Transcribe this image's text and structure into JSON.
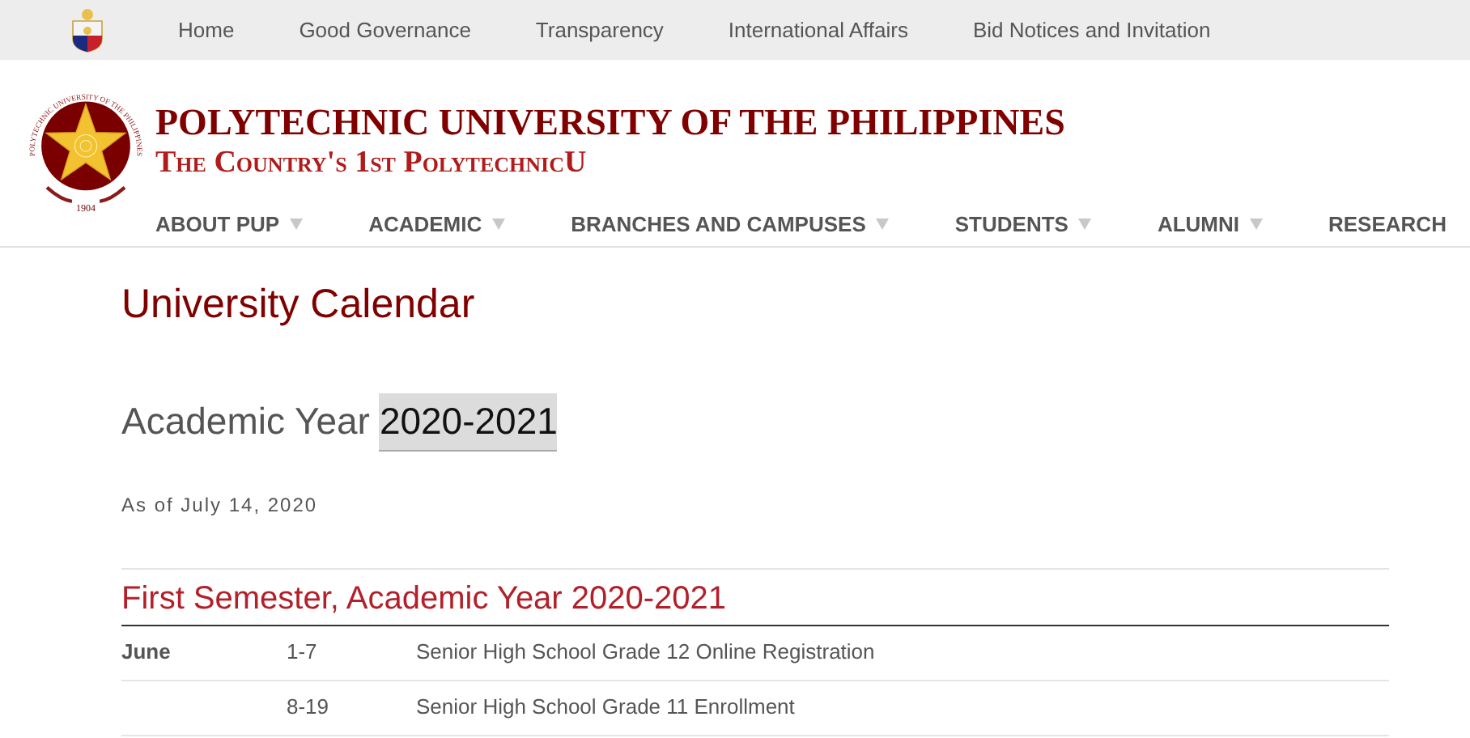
{
  "top_bar": {
    "links": [
      "Home",
      "Good Governance",
      "Transparency",
      "International Affairs",
      "Bid Notices and Invitation"
    ]
  },
  "header": {
    "seal_ring_text": "POLYTECHNIC UNIVERSITY OF THE PHILIPPINES",
    "seal_year": "1904",
    "title": "POLYTECHNIC UNIVERSITY OF THE PHILIPPINES",
    "subtitle": "The Country's 1st PolytechnicU",
    "nav": [
      {
        "label": "ABOUT PUP",
        "has_dropdown": true
      },
      {
        "label": "ACADEMIC",
        "has_dropdown": true
      },
      {
        "label": "BRANCHES AND CAMPUSES",
        "has_dropdown": true
      },
      {
        "label": "STUDENTS",
        "has_dropdown": true
      },
      {
        "label": "ALUMNI",
        "has_dropdown": true
      },
      {
        "label": "RESEARCH",
        "has_dropdown": false
      }
    ]
  },
  "page": {
    "title": "University Calendar",
    "year_label": "Academic Year",
    "year": {
      "text": "2020-2021",
      "highlighted": true
    },
    "as_of": "As of July 14, 2020",
    "section": {
      "title": "First Semester, Academic Year 2020-2021",
      "rows": [
        {
          "month": "June",
          "dates": "1-7",
          "event": "Senior High School Grade 12 Online Registration"
        },
        {
          "month": "",
          "dates": "8-19",
          "event": "Senior High School Grade 11 Enrollment"
        }
      ]
    }
  }
}
